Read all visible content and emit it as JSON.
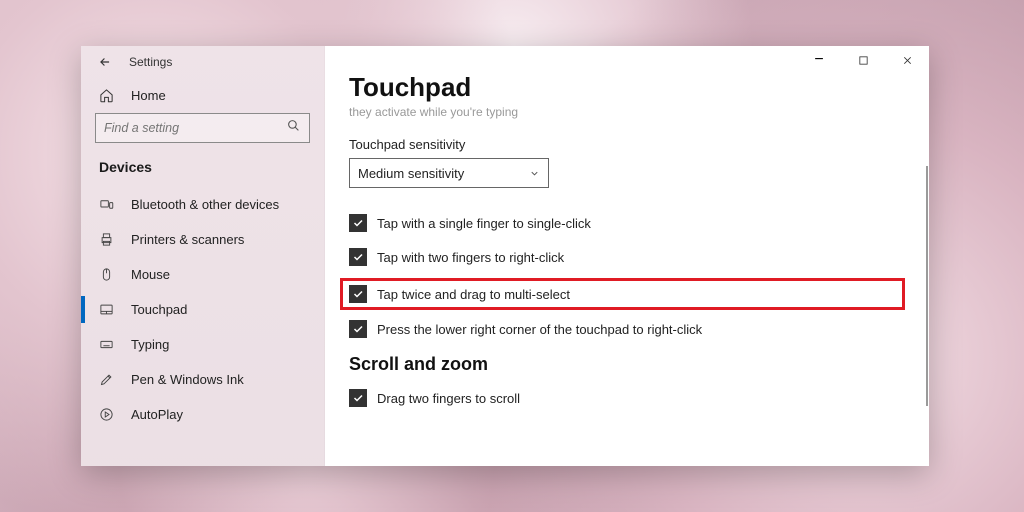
{
  "window": {
    "title": "Settings"
  },
  "titlebar": {
    "min": "−",
    "max": "▢",
    "close": "✕"
  },
  "sidebar": {
    "home": "Home",
    "search_placeholder": "Find a setting",
    "section": "Devices",
    "items": [
      {
        "label": "Bluetooth & other devices",
        "icon": "devices"
      },
      {
        "label": "Printers & scanners",
        "icon": "printer"
      },
      {
        "label": "Mouse",
        "icon": "mouse"
      },
      {
        "label": "Touchpad",
        "icon": "touchpad",
        "active": true
      },
      {
        "label": "Typing",
        "icon": "keyboard"
      },
      {
        "label": "Pen & Windows Ink",
        "icon": "pen"
      },
      {
        "label": "AutoPlay",
        "icon": "autoplay"
      }
    ]
  },
  "page": {
    "title": "Touchpad",
    "hint_cut": "they activate while you're typing",
    "sensitivity_label": "Touchpad sensitivity",
    "sensitivity_value": "Medium sensitivity",
    "options": [
      {
        "label": "Tap with a single finger to single-click",
        "checked": true
      },
      {
        "label": "Tap with two fingers to right-click",
        "checked": true
      },
      {
        "label": "Tap twice and drag to multi-select",
        "checked": true,
        "highlight": true
      },
      {
        "label": "Press the lower right corner of the touchpad to right-click",
        "checked": true
      }
    ],
    "scroll_section": "Scroll and zoom",
    "scroll_opt": {
      "label": "Drag two fingers to scroll",
      "checked": true
    }
  }
}
